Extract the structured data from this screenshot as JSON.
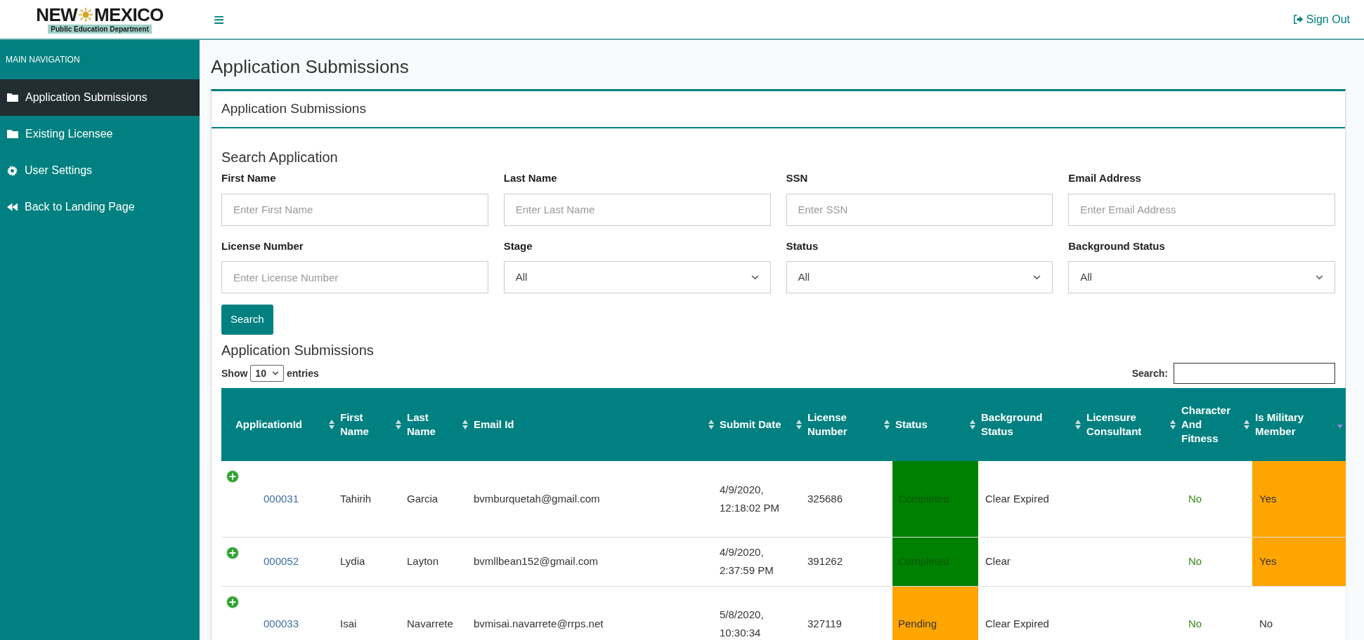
{
  "logo": {
    "title_left": "NEW",
    "title_right": "MEXICO",
    "subtitle": "Public Education Department"
  },
  "header": {
    "menu_icon": "≡",
    "sign_out": "Sign Out"
  },
  "sidebar": {
    "heading": "MAIN NAVIGATION",
    "items": [
      {
        "label": "Application Submissions",
        "selected": true
      },
      {
        "label": "Existing Licensee",
        "selected": false
      },
      {
        "label": "User Settings",
        "selected": false
      },
      {
        "label": "Back to Landing Page",
        "selected": false
      }
    ]
  },
  "page_title": "Application Submissions",
  "card_title": "Application Submissions",
  "search": {
    "heading": "Search Application",
    "fields": [
      {
        "label": "First Name",
        "kind": "text",
        "placeholder": "Enter First Name"
      },
      {
        "label": "Last Name",
        "kind": "text",
        "placeholder": "Enter Last Name"
      },
      {
        "label": "SSN",
        "kind": "text",
        "placeholder": "Enter SSN"
      },
      {
        "label": "Email Address",
        "kind": "text",
        "placeholder": "Enter Email Address"
      },
      {
        "label": "License Number",
        "kind": "text",
        "placeholder": "Enter License Number"
      },
      {
        "label": "Stage",
        "kind": "select",
        "value": "All"
      },
      {
        "label": "Status",
        "kind": "select",
        "value": "All"
      },
      {
        "label": "Background Status",
        "kind": "select",
        "value": "All"
      }
    ],
    "button": "Search"
  },
  "results": {
    "heading": "Application Submissions",
    "show_label": "Show",
    "page_size": "10",
    "entries_label": "entries",
    "search_label": "Search:"
  },
  "table": {
    "columns": [
      {
        "label": "ApplicationId",
        "sorted": false
      },
      {
        "label": "First Name",
        "sorted": false
      },
      {
        "label": "Last Name",
        "sorted": false
      },
      {
        "label": "Email Id",
        "sorted": false
      },
      {
        "label": "Submit Date",
        "sorted": false
      },
      {
        "label": "License Number",
        "sorted": false
      },
      {
        "label": "Status",
        "sorted": false
      },
      {
        "label": "Background Status",
        "sorted": false
      },
      {
        "label": "Licensure Consultant",
        "sorted": false
      },
      {
        "label": "Character And Fitness",
        "sorted": false
      },
      {
        "label": "Is Military Member",
        "sorted": true
      }
    ],
    "rows": [
      {
        "id": "000031",
        "first": "Tahirih",
        "last": "Garcia",
        "email": "bvmburquetah@gmail.com",
        "submit": "4/9/2020, 12:18:02 PM",
        "license": "325686",
        "status": {
          "text": "Completed",
          "color": "#008000"
        },
        "background": "Clear Expired",
        "fitness": "No",
        "military": {
          "text": "Yes",
          "color": "#ffa500"
        }
      },
      {
        "id": "000052",
        "first": "Lydia",
        "last": "Layton",
        "email": "bvmllbean152@gmail.com",
        "submit": "4/9/2020, 2:37:59 PM",
        "license": "391262",
        "status": {
          "text": "Completed",
          "color": "#008000"
        },
        "background": "Clear",
        "fitness": "No",
        "military": {
          "text": "Yes",
          "color": "#ffa500"
        }
      },
      {
        "id": "000033",
        "first": "Isai",
        "last": "Navarrete",
        "email": "bvmisai.navarrete@rrps.net",
        "submit": "5/8/2020, 10:30:34",
        "license": "327119",
        "status": {
          "text": "Pending",
          "color": "#ffa500"
        },
        "background": "Clear Expired",
        "fitness": "No",
        "military": {
          "text": "No"
        }
      }
    ]
  }
}
